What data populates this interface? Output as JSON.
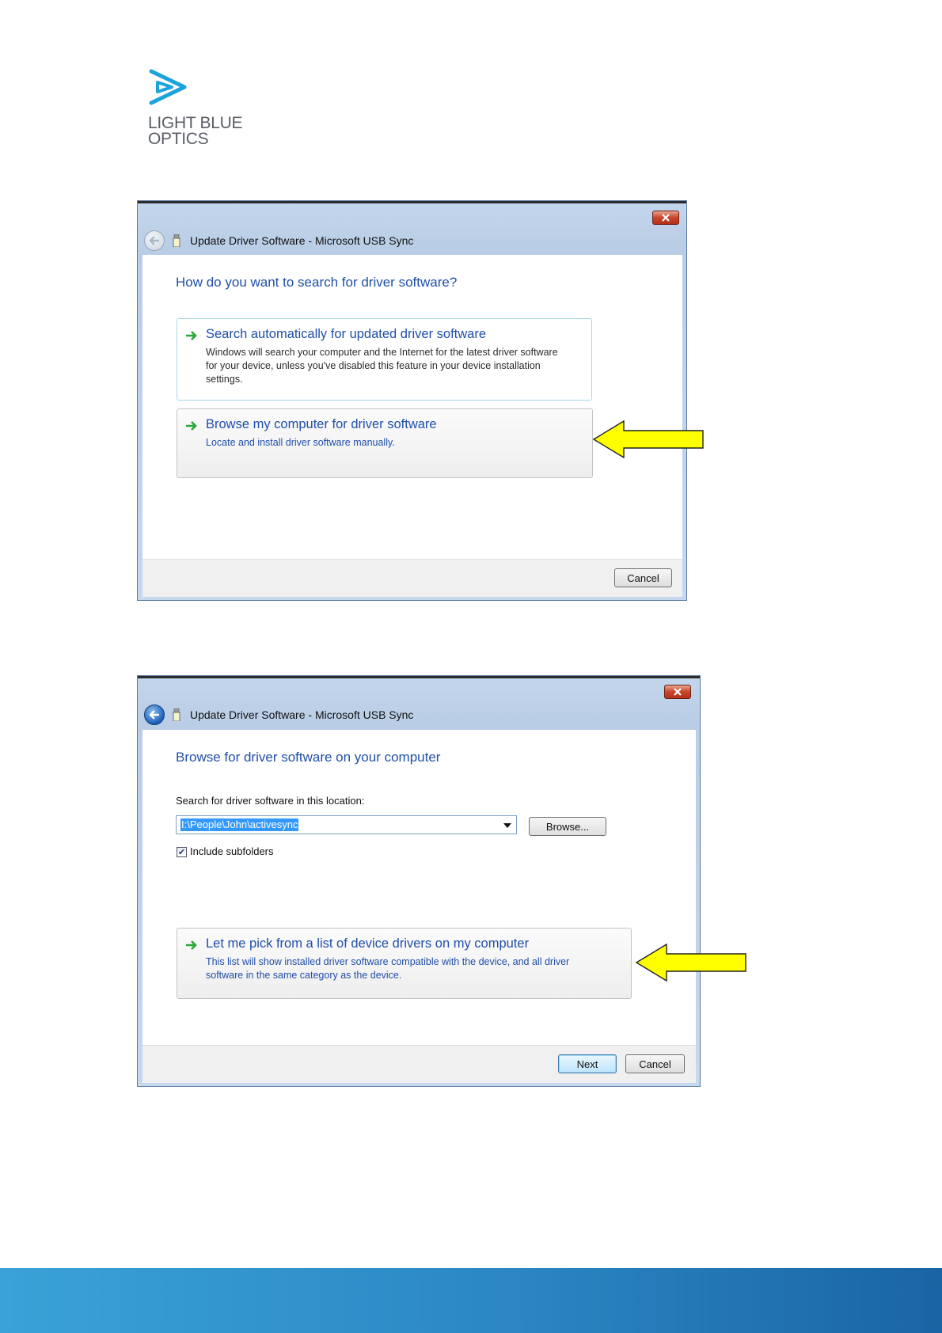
{
  "logo": {
    "line1": "LIGHT BLUE",
    "line2": "OPTICS",
    "color": "#1ba3dc"
  },
  "dialog1": {
    "title": "Update Driver Software - Microsoft USB Sync",
    "heading": "How do you want to search for driver software?",
    "option_auto": {
      "title": "Search automatically for updated driver software",
      "desc_line1": "Windows will search your computer and the Internet for the latest driver software",
      "desc_line2": "for your device, unless you've disabled this feature in your device installation",
      "desc_line3": "settings."
    },
    "option_browse": {
      "title": "Browse my computer for driver software",
      "desc": "Locate and install driver software manually."
    },
    "cancel_label": "Cancel"
  },
  "dialog2": {
    "title": "Update Driver Software - Microsoft USB Sync",
    "heading": "Browse for driver software on your computer",
    "search_label": "Search for driver software in this location:",
    "path_value": "I:\\People\\John\\activesync",
    "browse_label": "Browse...",
    "include_subfolders_label": "Include subfolders",
    "include_subfolders_checked": true,
    "option_pick": {
      "title": "Let me pick from a list of device drivers on my computer",
      "desc_line1": "This list will show installed driver software compatible with the device, and all driver",
      "desc_line2": "software in the same category as the device."
    },
    "next_label": "Next",
    "cancel_label": "Cancel"
  },
  "colors": {
    "arrow_fill": "#ffff00",
    "heading_blue": "#1f4fa8",
    "band_start": "#3aa2d8",
    "band_end": "#1a64a4"
  }
}
